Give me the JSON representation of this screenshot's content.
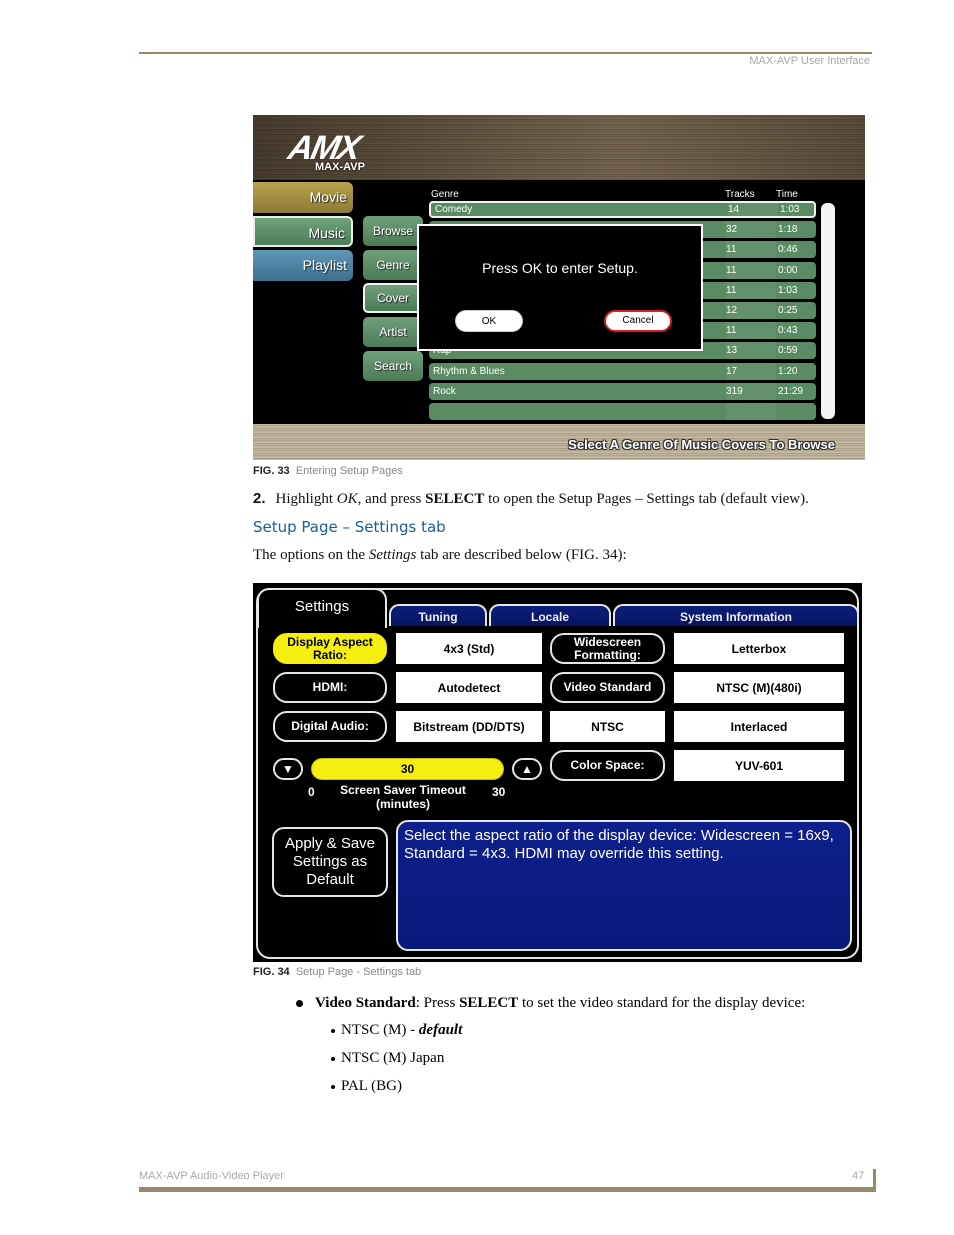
{
  "header": {
    "title": "MAX-AVP User Interface"
  },
  "fig33": {
    "logo": "AMX",
    "logo_sub": "MAX-AVP",
    "main_tabs": [
      {
        "label": "Movie",
        "color": "#b8a24e"
      },
      {
        "label": "Music",
        "color": "#6ea37a"
      },
      {
        "label": "Playlist",
        "color": "#5e97b8"
      }
    ],
    "sub_buttons": [
      "Browse",
      "Genre",
      "Cover",
      "Artist",
      "Search"
    ],
    "columns": {
      "genre": "Genre",
      "tracks": "Tracks",
      "time": "Time"
    },
    "rows": [
      {
        "name": "Comedy",
        "tracks": "14",
        "time": "1:03"
      },
      {
        "name": "",
        "tracks": "32",
        "time": "1:18"
      },
      {
        "name": "",
        "tracks": "11",
        "time": "0:46"
      },
      {
        "name": "",
        "tracks": "11",
        "time": "0:00"
      },
      {
        "name": "",
        "tracks": "11",
        "time": "1:03"
      },
      {
        "name": "",
        "tracks": "12",
        "time": "0:25"
      },
      {
        "name": "",
        "tracks": "11",
        "time": "0:43"
      },
      {
        "name": "Rap",
        "tracks": "13",
        "time": "0:59"
      },
      {
        "name": "Rhythm & Blues",
        "tracks": "17",
        "time": "1:20"
      },
      {
        "name": "Rock",
        "tracks": "319",
        "time": "21:29"
      },
      {
        "name": "",
        "tracks": "",
        "time": ""
      }
    ],
    "dialog": {
      "message": "Press OK to enter Setup.",
      "ok": "OK",
      "cancel": "Cancel"
    },
    "bottom_caption": "Select A Genre Of Music Covers To Browse"
  },
  "fig33_caption": {
    "num": "FIG. 33",
    "text": "Entering Setup Pages"
  },
  "step2": {
    "num": "2.",
    "pre": "Highlight ",
    "italic": "OK",
    "mid": ", and press ",
    "bold": "SELECT",
    "post": " to open the Setup Pages – Settings tab (default view)."
  },
  "section_title": "Setup Page – Settings tab",
  "intro": {
    "pre": "The options on the ",
    "italic": "Settings",
    "post": " tab are described below (FIG. 34):"
  },
  "fig34": {
    "tabs": {
      "active": "Settings",
      "tuning": "Tuning",
      "locale": "Locale",
      "sysinfo": "System Information"
    },
    "left": [
      {
        "label": "Display Aspect Ratio:",
        "value": "4x3 (Std)",
        "highlighted": true
      },
      {
        "label": "HDMI:",
        "value": "Autodetect"
      },
      {
        "label": "Digital Audio:",
        "value": "Bitstream (DD/DTS)"
      }
    ],
    "right": [
      {
        "label": "Widescreen Formatting:",
        "value": "Letterbox"
      },
      {
        "label": "Video Standard",
        "value": "NTSC (M)(480i)"
      },
      {
        "label": "NTSC",
        "value": "Interlaced"
      },
      {
        "label": "Color Space:",
        "value": "YUV-601"
      }
    ],
    "slider": {
      "value": "30",
      "min": "0",
      "max": "30",
      "label": "Screen Saver Timeout",
      "unit": "(minutes)",
      "fill_fraction": 1.0
    },
    "apply_button": "Apply & Save Settings as Default",
    "help_text": "Select the aspect ratio of the display device: Widescreen = 16x9, Standard = 4x3.  HDMI may override this setting."
  },
  "fig34_caption": {
    "num": "FIG. 34",
    "text": "Setup Page - Settings tab"
  },
  "video_standard": {
    "bold": "Video Standard",
    "pre": ": Press ",
    "bold2": "SELECT",
    "post": " to set the video standard for the display device:",
    "options": [
      {
        "text": "NTSC (M) - ",
        "emph": "default"
      },
      {
        "text": "NTSC (M) Japan",
        "emph": ""
      },
      {
        "text": "PAL (BG)",
        "emph": ""
      }
    ]
  },
  "footer": {
    "title": "MAX-AVP Audio-Video Player",
    "page": "47"
  }
}
